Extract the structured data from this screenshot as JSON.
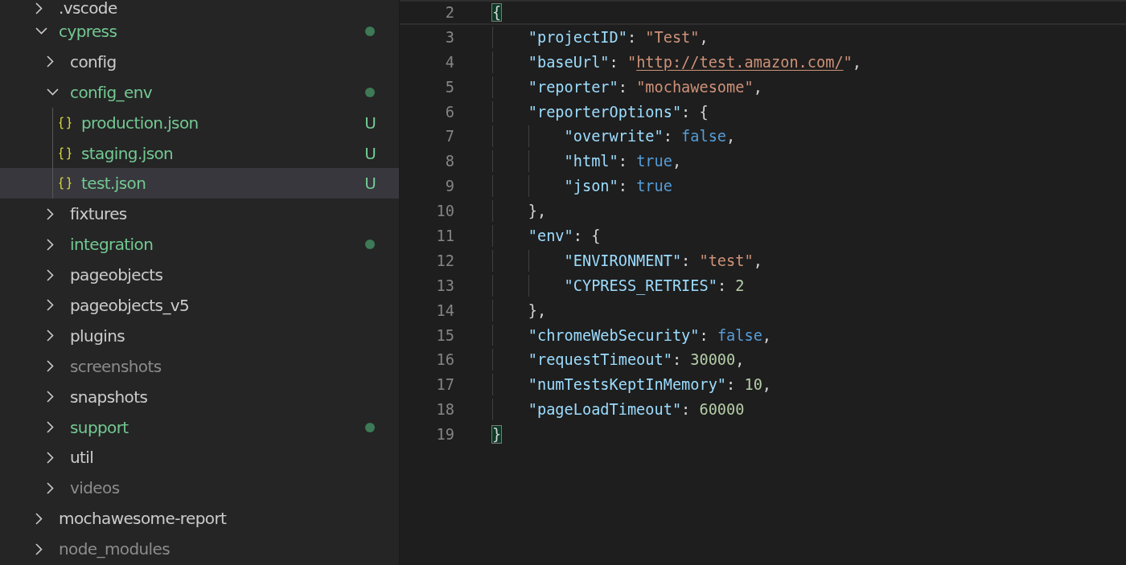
{
  "explorer": {
    "items": [
      {
        "name": ".vscode",
        "kind": "folder",
        "expanded": false,
        "modified": false,
        "ignored": false,
        "selected": false
      },
      {
        "name": "cypress",
        "kind": "folder",
        "expanded": true,
        "modified": true,
        "ignored": false,
        "selected": false,
        "children": [
          {
            "name": "config",
            "kind": "folder",
            "expanded": false,
            "modified": false,
            "ignored": false,
            "selected": false
          },
          {
            "name": "config_env",
            "kind": "folder",
            "expanded": true,
            "modified": true,
            "ignored": false,
            "selected": false,
            "children": [
              {
                "name": "production.json",
                "kind": "file",
                "modified": false,
                "ignored": false,
                "badge": "U",
                "selected": false
              },
              {
                "name": "staging.json",
                "kind": "file",
                "modified": false,
                "ignored": false,
                "badge": "U",
                "selected": false
              },
              {
                "name": "test.json",
                "kind": "file",
                "modified": false,
                "ignored": false,
                "badge": "U",
                "selected": true
              }
            ]
          },
          {
            "name": "fixtures",
            "kind": "folder",
            "expanded": false,
            "modified": false,
            "ignored": false,
            "selected": false
          },
          {
            "name": "integration",
            "kind": "folder",
            "expanded": false,
            "modified": true,
            "ignored": false,
            "selected": false
          },
          {
            "name": "pageobjects",
            "kind": "folder",
            "expanded": false,
            "modified": false,
            "ignored": false,
            "selected": false
          },
          {
            "name": "pageobjects_v5",
            "kind": "folder",
            "expanded": false,
            "modified": false,
            "ignored": false,
            "selected": false
          },
          {
            "name": "plugins",
            "kind": "folder",
            "expanded": false,
            "modified": false,
            "ignored": false,
            "selected": false
          },
          {
            "name": "screenshots",
            "kind": "folder",
            "expanded": false,
            "modified": false,
            "ignored": true,
            "selected": false
          },
          {
            "name": "snapshots",
            "kind": "folder",
            "expanded": false,
            "modified": false,
            "ignored": false,
            "selected": false
          },
          {
            "name": "support",
            "kind": "folder",
            "expanded": false,
            "modified": true,
            "ignored": false,
            "selected": false
          },
          {
            "name": "util",
            "kind": "folder",
            "expanded": false,
            "modified": false,
            "ignored": false,
            "selected": false
          },
          {
            "name": "videos",
            "kind": "folder",
            "expanded": false,
            "modified": false,
            "ignored": true,
            "selected": false
          }
        ]
      },
      {
        "name": "mochawesome-report",
        "kind": "folder",
        "expanded": false,
        "modified": false,
        "ignored": false,
        "selected": false
      },
      {
        "name": "node_modules",
        "kind": "folder",
        "expanded": false,
        "modified": false,
        "ignored": true,
        "selected": false
      }
    ]
  },
  "editor": {
    "lines": [
      {
        "number": "2",
        "current": true,
        "tokens": [
          {
            "kind": "bracket",
            "text": "{",
            "matched": true
          }
        ]
      },
      {
        "number": "3",
        "current": false,
        "tokens": [
          {
            "kind": "key",
            "text": "    \"projectID\""
          },
          {
            "kind": "punct",
            "text": ": "
          },
          {
            "kind": "string",
            "text": "\"Test\""
          },
          {
            "kind": "punct",
            "text": ","
          }
        ]
      },
      {
        "number": "4",
        "current": false,
        "tokens": [
          {
            "kind": "key",
            "text": "    \"baseUrl\""
          },
          {
            "kind": "punct",
            "text": ": "
          },
          {
            "kind": "string",
            "text": "\""
          },
          {
            "kind": "link",
            "text": "http://test.amazon.com/"
          },
          {
            "kind": "string",
            "text": "\""
          },
          {
            "kind": "punct",
            "text": ","
          }
        ]
      },
      {
        "number": "5",
        "current": false,
        "tokens": [
          {
            "kind": "key",
            "text": "    \"reporter\""
          },
          {
            "kind": "punct",
            "text": ": "
          },
          {
            "kind": "string",
            "text": "\"mochawesome\""
          },
          {
            "kind": "punct",
            "text": ","
          }
        ]
      },
      {
        "number": "6",
        "current": false,
        "tokens": [
          {
            "kind": "key",
            "text": "    \"reporterOptions\""
          },
          {
            "kind": "punct",
            "text": ": {"
          }
        ]
      },
      {
        "number": "7",
        "current": false,
        "tokens": [
          {
            "kind": "key",
            "text": "        \"overwrite\""
          },
          {
            "kind": "punct",
            "text": ": "
          },
          {
            "kind": "bool",
            "text": "false"
          },
          {
            "kind": "punct",
            "text": ","
          }
        ]
      },
      {
        "number": "8",
        "current": false,
        "tokens": [
          {
            "kind": "key",
            "text": "        \"html\""
          },
          {
            "kind": "punct",
            "text": ": "
          },
          {
            "kind": "bool",
            "text": "true"
          },
          {
            "kind": "punct",
            "text": ","
          }
        ]
      },
      {
        "number": "9",
        "current": false,
        "tokens": [
          {
            "kind": "key",
            "text": "        \"json\""
          },
          {
            "kind": "punct",
            "text": ": "
          },
          {
            "kind": "bool",
            "text": "true"
          }
        ]
      },
      {
        "number": "10",
        "current": false,
        "tokens": [
          {
            "kind": "punct",
            "text": "    },"
          }
        ]
      },
      {
        "number": "11",
        "current": false,
        "tokens": [
          {
            "kind": "key",
            "text": "    \"env\""
          },
          {
            "kind": "punct",
            "text": ": {"
          }
        ]
      },
      {
        "number": "12",
        "current": false,
        "tokens": [
          {
            "kind": "key",
            "text": "        \"ENVIRONMENT\""
          },
          {
            "kind": "punct",
            "text": ": "
          },
          {
            "kind": "string",
            "text": "\"test\""
          },
          {
            "kind": "punct",
            "text": ","
          }
        ]
      },
      {
        "number": "13",
        "current": false,
        "tokens": [
          {
            "kind": "key",
            "text": "        \"CYPRESS_RETRIES\""
          },
          {
            "kind": "punct",
            "text": ": "
          },
          {
            "kind": "number",
            "text": "2"
          }
        ]
      },
      {
        "number": "14",
        "current": false,
        "tokens": [
          {
            "kind": "punct",
            "text": "    },"
          }
        ]
      },
      {
        "number": "15",
        "current": false,
        "tokens": [
          {
            "kind": "key",
            "text": "    \"chromeWebSecurity\""
          },
          {
            "kind": "punct",
            "text": ": "
          },
          {
            "kind": "bool",
            "text": "false"
          },
          {
            "kind": "punct",
            "text": ","
          }
        ]
      },
      {
        "number": "16",
        "current": false,
        "tokens": [
          {
            "kind": "key",
            "text": "    \"requestTimeout\""
          },
          {
            "kind": "punct",
            "text": ": "
          },
          {
            "kind": "number",
            "text": "30000"
          },
          {
            "kind": "punct",
            "text": ","
          }
        ]
      },
      {
        "number": "17",
        "current": false,
        "tokens": [
          {
            "kind": "key",
            "text": "    \"numTestsKeptInMemory\""
          },
          {
            "kind": "punct",
            "text": ": "
          },
          {
            "kind": "number",
            "text": "10"
          },
          {
            "kind": "punct",
            "text": ","
          }
        ]
      },
      {
        "number": "18",
        "current": false,
        "tokens": [
          {
            "kind": "key",
            "text": "    \"pageLoadTimeout\""
          },
          {
            "kind": "punct",
            "text": ": "
          },
          {
            "kind": "number",
            "text": "60000"
          }
        ]
      },
      {
        "number": "19",
        "current": false,
        "tokens": [
          {
            "kind": "bracket",
            "text": "}",
            "matched": true
          }
        ]
      }
    ]
  }
}
